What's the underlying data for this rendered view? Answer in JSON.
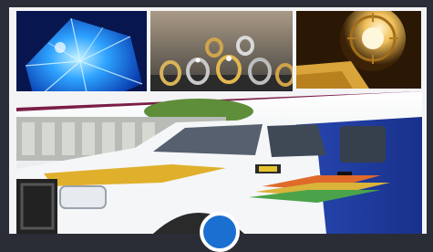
{
  "gallery": {
    "images": [
      {
        "subject": "blue-diamond"
      },
      {
        "subject": "gold-rings-display"
      },
      {
        "subject": "gold-bars-vault"
      },
      {
        "subject": "armored-cash-van"
      }
    ],
    "badge": {
      "color": "#1a6fd1"
    }
  }
}
